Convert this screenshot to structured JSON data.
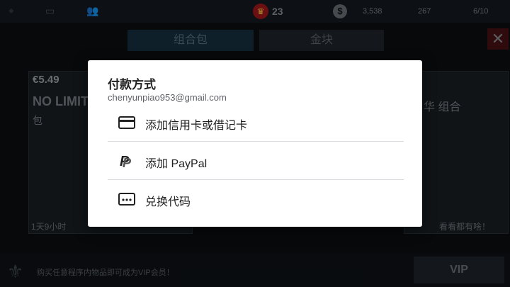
{
  "topbar": {
    "crown_value": "23",
    "cash_value": "3,538",
    "gold_value": "267",
    "fuel_value": "6/10"
  },
  "tabs": [
    {
      "label": "组合包"
    },
    {
      "label": "金块"
    }
  ],
  "background": {
    "left_card": {
      "price": "€5.49",
      "title": "NO LIMIT",
      "subtitle": "包",
      "timer": "1天9小时"
    },
    "right_card": {
      "title": "华 组合",
      "footer_link": "看看都有啥！"
    },
    "bottom_text": "购买任意程序内物品即可成为VIP会员！",
    "vip_button": "VIP"
  },
  "dialog": {
    "title": "付款方式",
    "email": "chenyunpiao953@gmail.com",
    "options": [
      {
        "label": "添加信用卡或借记卡",
        "icon": "credit-card-icon"
      },
      {
        "label": "添加 PayPal",
        "icon": "paypal-icon"
      },
      {
        "label": "兑换代码",
        "icon": "redeem-code-icon"
      }
    ]
  }
}
